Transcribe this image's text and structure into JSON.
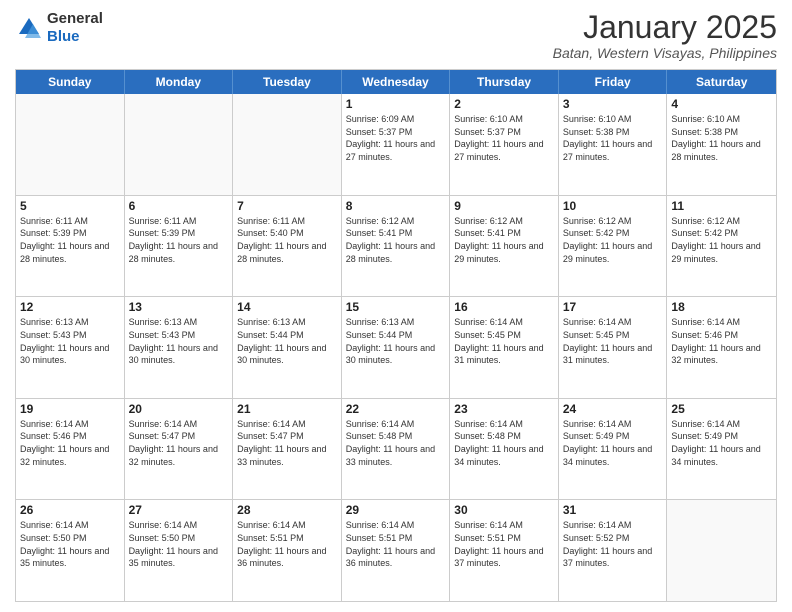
{
  "logo": {
    "general": "General",
    "blue": "Blue"
  },
  "header": {
    "month": "January 2025",
    "location": "Batan, Western Visayas, Philippines"
  },
  "days": [
    "Sunday",
    "Monday",
    "Tuesday",
    "Wednesday",
    "Thursday",
    "Friday",
    "Saturday"
  ],
  "weeks": [
    [
      {
        "day": "",
        "info": ""
      },
      {
        "day": "",
        "info": ""
      },
      {
        "day": "",
        "info": ""
      },
      {
        "day": "1",
        "info": "Sunrise: 6:09 AM\nSunset: 5:37 PM\nDaylight: 11 hours and 27 minutes."
      },
      {
        "day": "2",
        "info": "Sunrise: 6:10 AM\nSunset: 5:37 PM\nDaylight: 11 hours and 27 minutes."
      },
      {
        "day": "3",
        "info": "Sunrise: 6:10 AM\nSunset: 5:38 PM\nDaylight: 11 hours and 27 minutes."
      },
      {
        "day": "4",
        "info": "Sunrise: 6:10 AM\nSunset: 5:38 PM\nDaylight: 11 hours and 28 minutes."
      }
    ],
    [
      {
        "day": "5",
        "info": "Sunrise: 6:11 AM\nSunset: 5:39 PM\nDaylight: 11 hours and 28 minutes."
      },
      {
        "day": "6",
        "info": "Sunrise: 6:11 AM\nSunset: 5:39 PM\nDaylight: 11 hours and 28 minutes."
      },
      {
        "day": "7",
        "info": "Sunrise: 6:11 AM\nSunset: 5:40 PM\nDaylight: 11 hours and 28 minutes."
      },
      {
        "day": "8",
        "info": "Sunrise: 6:12 AM\nSunset: 5:41 PM\nDaylight: 11 hours and 28 minutes."
      },
      {
        "day": "9",
        "info": "Sunrise: 6:12 AM\nSunset: 5:41 PM\nDaylight: 11 hours and 29 minutes."
      },
      {
        "day": "10",
        "info": "Sunrise: 6:12 AM\nSunset: 5:42 PM\nDaylight: 11 hours and 29 minutes."
      },
      {
        "day": "11",
        "info": "Sunrise: 6:12 AM\nSunset: 5:42 PM\nDaylight: 11 hours and 29 minutes."
      }
    ],
    [
      {
        "day": "12",
        "info": "Sunrise: 6:13 AM\nSunset: 5:43 PM\nDaylight: 11 hours and 30 minutes."
      },
      {
        "day": "13",
        "info": "Sunrise: 6:13 AM\nSunset: 5:43 PM\nDaylight: 11 hours and 30 minutes."
      },
      {
        "day": "14",
        "info": "Sunrise: 6:13 AM\nSunset: 5:44 PM\nDaylight: 11 hours and 30 minutes."
      },
      {
        "day": "15",
        "info": "Sunrise: 6:13 AM\nSunset: 5:44 PM\nDaylight: 11 hours and 30 minutes."
      },
      {
        "day": "16",
        "info": "Sunrise: 6:14 AM\nSunset: 5:45 PM\nDaylight: 11 hours and 31 minutes."
      },
      {
        "day": "17",
        "info": "Sunrise: 6:14 AM\nSunset: 5:45 PM\nDaylight: 11 hours and 31 minutes."
      },
      {
        "day": "18",
        "info": "Sunrise: 6:14 AM\nSunset: 5:46 PM\nDaylight: 11 hours and 32 minutes."
      }
    ],
    [
      {
        "day": "19",
        "info": "Sunrise: 6:14 AM\nSunset: 5:46 PM\nDaylight: 11 hours and 32 minutes."
      },
      {
        "day": "20",
        "info": "Sunrise: 6:14 AM\nSunset: 5:47 PM\nDaylight: 11 hours and 32 minutes."
      },
      {
        "day": "21",
        "info": "Sunrise: 6:14 AM\nSunset: 5:47 PM\nDaylight: 11 hours and 33 minutes."
      },
      {
        "day": "22",
        "info": "Sunrise: 6:14 AM\nSunset: 5:48 PM\nDaylight: 11 hours and 33 minutes."
      },
      {
        "day": "23",
        "info": "Sunrise: 6:14 AM\nSunset: 5:48 PM\nDaylight: 11 hours and 34 minutes."
      },
      {
        "day": "24",
        "info": "Sunrise: 6:14 AM\nSunset: 5:49 PM\nDaylight: 11 hours and 34 minutes."
      },
      {
        "day": "25",
        "info": "Sunrise: 6:14 AM\nSunset: 5:49 PM\nDaylight: 11 hours and 34 minutes."
      }
    ],
    [
      {
        "day": "26",
        "info": "Sunrise: 6:14 AM\nSunset: 5:50 PM\nDaylight: 11 hours and 35 minutes."
      },
      {
        "day": "27",
        "info": "Sunrise: 6:14 AM\nSunset: 5:50 PM\nDaylight: 11 hours and 35 minutes."
      },
      {
        "day": "28",
        "info": "Sunrise: 6:14 AM\nSunset: 5:51 PM\nDaylight: 11 hours and 36 minutes."
      },
      {
        "day": "29",
        "info": "Sunrise: 6:14 AM\nSunset: 5:51 PM\nDaylight: 11 hours and 36 minutes."
      },
      {
        "day": "30",
        "info": "Sunrise: 6:14 AM\nSunset: 5:51 PM\nDaylight: 11 hours and 37 minutes."
      },
      {
        "day": "31",
        "info": "Sunrise: 6:14 AM\nSunset: 5:52 PM\nDaylight: 11 hours and 37 minutes."
      },
      {
        "day": "",
        "info": ""
      }
    ]
  ]
}
